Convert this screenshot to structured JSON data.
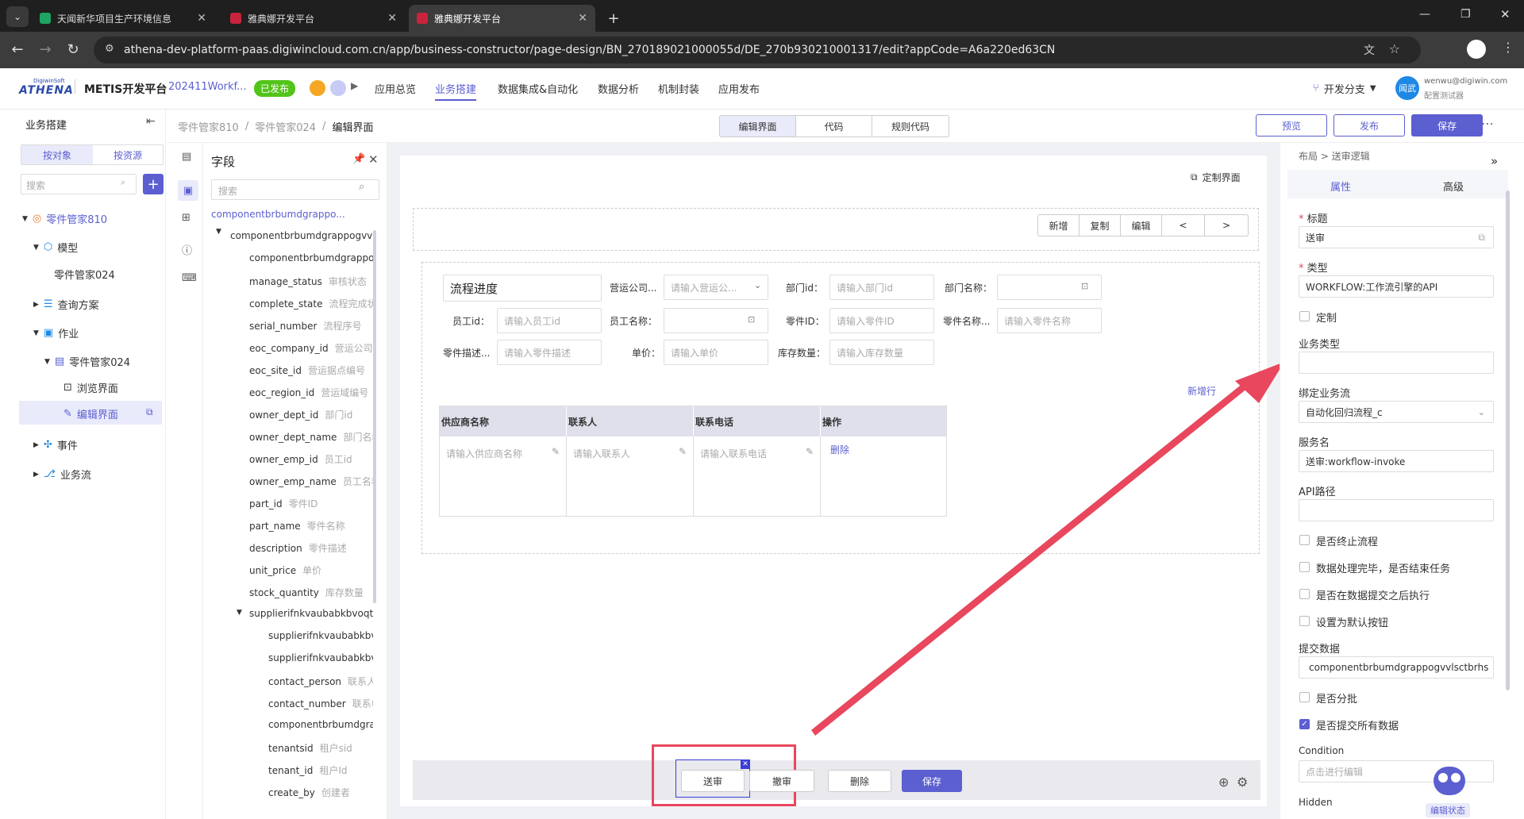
{
  "browser": {
    "tabs": [
      {
        "title": "天闻新华项目生产环境信息"
      },
      {
        "title": "雅典娜开发平台"
      },
      {
        "title": "雅典娜开发平台"
      }
    ],
    "url": "athena-dev-platform-paas.digiwincloud.com.cn/app/business-constructor/page-design/BN_270189021000055d/DE_270b930210001317/edit?appCode=A6a220ed63CN"
  },
  "header": {
    "logo": "ATHENA",
    "logo_top": "DigiwinSoft",
    "platform": "METIS开发平台",
    "app_name": "202411Workf...",
    "published": "已发布",
    "nav": [
      "应用总览",
      "业务搭建",
      "数据集成&自动化",
      "数据分析",
      "机制封装",
      "应用发布"
    ],
    "branch": "开发分支",
    "avatar": "闻武",
    "user_email": "wenwu@digiwin.com",
    "user_role": "配置测试器"
  },
  "sidebar": {
    "title": "业务搭建",
    "tabs": [
      "按对象",
      "按资源"
    ],
    "search_placeholder": "搜索",
    "tree": [
      "零件管家810",
      "模型",
      "零件管家024",
      "查询方案",
      "作业",
      "零件管家024",
      "浏览界面",
      "编辑界面",
      "事件",
      "业务流"
    ]
  },
  "breadcrumb": [
    "零件管家810",
    "零件管家024",
    "编辑界面"
  ],
  "editor_tabs": [
    "编辑界面",
    "代码",
    "规则代码"
  ],
  "top_actions": [
    "预览",
    "发布",
    "保存"
  ],
  "fields": {
    "title": "字段",
    "search_placeholder": "搜索",
    "root": "componentbrbumdgrappo...",
    "group": "componentbrbumdgrappogvvlsctbrhs",
    "items": [
      [
        "componentbrbumdgrappogvvlsctbrhs",
        ""
      ],
      [
        "manage_status",
        "审核状态"
      ],
      [
        "complete_state",
        "流程完成状态"
      ],
      [
        "serial_number",
        "流程序号"
      ],
      [
        "eoc_company_id",
        "营运公司"
      ],
      [
        "eoc_site_id",
        "营运据点编号"
      ],
      [
        "eoc_region_id",
        "营运域编号"
      ],
      [
        "owner_dept_id",
        "部门id"
      ],
      [
        "owner_dept_name",
        "部门名称"
      ],
      [
        "owner_emp_id",
        "员工id"
      ],
      [
        "owner_emp_name",
        "员工名称"
      ],
      [
        "part_id",
        "零件ID"
      ],
      [
        "part_name",
        "零件名称"
      ],
      [
        "description",
        "零件描述"
      ],
      [
        "unit_price",
        "单价"
      ],
      [
        "stock_quantity",
        "库存数量"
      ]
    ],
    "sub_group": "supplierifnkvaubabkbvoqtilt",
    "sub_items": [
      [
        "supplierifnkvaubabkbvoqtilt",
        ""
      ],
      [
        "supplierifnkvaubabkbvoqtilt",
        ""
      ],
      [
        "contact_person",
        "联系人"
      ],
      [
        "contact_number",
        "联系电话"
      ],
      [
        "componentbrbumdgrappogvvlsctbrhs",
        ""
      ],
      [
        "tenantsid",
        "租户sid"
      ],
      [
        "tenant_id",
        "租户Id"
      ],
      [
        "create_by",
        "创建者"
      ]
    ]
  },
  "canvas": {
    "custom_ui": "定制界面",
    "toolbar": [
      "新增",
      "复制",
      "编辑",
      "<",
      ">"
    ],
    "form_title": "流程进度",
    "form": [
      {
        "label": "营运公司...",
        "placeholder": "请输入营运公..."
      },
      {
        "label": "部门id：",
        "placeholder": "请输入部门id"
      },
      {
        "label": "部门名称：",
        "placeholder": ""
      },
      {
        "label": "员工id：",
        "placeholder": "请输入员工id"
      },
      {
        "label": "员工名称：",
        "placeholder": ""
      },
      {
        "label": "零件ID：",
        "placeholder": "请输入零件ID"
      },
      {
        "label": "零件名称...",
        "placeholder": "请输入零件名称"
      },
      {
        "label": "零件描述...",
        "placeholder": "请输入零件描述"
      },
      {
        "label": "单价：",
        "placeholder": "请输入单价"
      },
      {
        "label": "库存数量：",
        "placeholder": "请输入库存数量"
      }
    ],
    "add_row": "新增行",
    "table_headers": [
      "供应商名称",
      "联系人",
      "联系电话",
      "操作"
    ],
    "table_placeholders": [
      "请输入供应商名称",
      "请输入联系人",
      "请输入联系电话"
    ],
    "delete": "删除",
    "bottom_buttons": [
      "送审",
      "撤审",
      "删除",
      "保存"
    ]
  },
  "props": {
    "breadcrumb": "布局 > 送审逻辑",
    "tabs": [
      "属性",
      "高级"
    ],
    "title_label": "标题",
    "title_value": "送审",
    "type_label": "类型",
    "type_value": "WORKFLOW:工作流引擎的API",
    "custom": "定制",
    "biz_type_label": "业务类型",
    "bind_flow_label": "绑定业务流",
    "bind_flow_value": "自动化回归流程_c",
    "service_label": "服务名",
    "service_value": "送审:workflow-invoke",
    "api_label": "API路径",
    "checks": [
      "是否终止流程",
      "数据处理完毕，是否结束任务",
      "是否在数据提交之后执行",
      "设置为默认按钮"
    ],
    "submit_label": "提交数据",
    "submit_value": "componentbrbumdgrappogvvlsctbrhs",
    "split": "是否分批",
    "submit_all": "是否提交所有数据",
    "condition_label": "Condition",
    "condition_placeholder": "点击进行编辑",
    "hidden_label": "Hidden",
    "edit_state": "编辑状态"
  },
  "colors": {
    "accent": "#5b5fd0",
    "annotation": "#e8475d",
    "published": "#52c41a"
  }
}
